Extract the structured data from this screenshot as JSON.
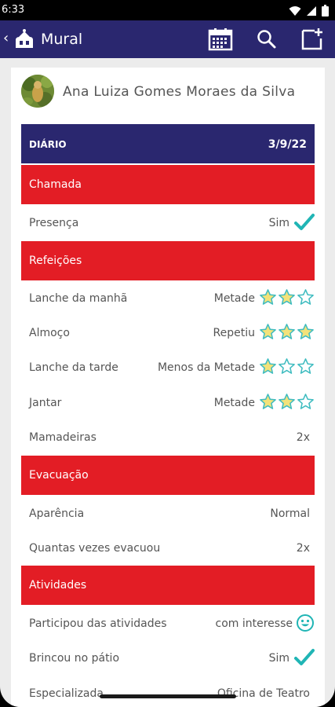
{
  "status_bar": {
    "time": "6:33"
  },
  "app_bar": {
    "back": "‹",
    "title": "Mural"
  },
  "profile": {
    "name": "Ana Luiza Gomes Moraes da Silva"
  },
  "diary": {
    "title": "DIÁRIO",
    "date": "3/9/22"
  },
  "sections": {
    "chamada": "Chamada",
    "refeicoes": "Refeições",
    "evacuacao": "Evacuação",
    "atividades": "Atividades"
  },
  "rows": {
    "presenca": {
      "label": "Presença",
      "value": "Sim",
      "icon": "check-icon"
    },
    "lanche_manha": {
      "label": "Lanche da manhã",
      "value": "Metade",
      "stars": 2
    },
    "almoco": {
      "label": "Almoço",
      "value": "Repetiu",
      "stars": 3
    },
    "lanche_tarde": {
      "label": "Lanche da tarde",
      "value": "Menos da Metade",
      "stars": 1
    },
    "jantar": {
      "label": "Jantar",
      "value": "Metade",
      "stars": 2
    },
    "mamadeiras": {
      "label": "Mamadeiras",
      "value": "2x"
    },
    "aparencia": {
      "label": "Aparência",
      "value": "Normal"
    },
    "quantas_vezes": {
      "label": "Quantas vezes evacuou",
      "value": "2x"
    },
    "participou": {
      "label": "Participou das atividades",
      "value": "com interesse",
      "icon": "smiley-icon"
    },
    "brincou": {
      "label": "Brincou no pátio",
      "value": "Sim",
      "icon": "check-icon"
    },
    "especializada": {
      "label": "Especializada",
      "value": "Oficina de Teatro"
    }
  },
  "colors": {
    "primary": "#2a276f",
    "accent": "#e31d25",
    "check": "#20b5b5",
    "star_fill": "#f3e27a",
    "star_stroke": "#3fbcc0"
  }
}
